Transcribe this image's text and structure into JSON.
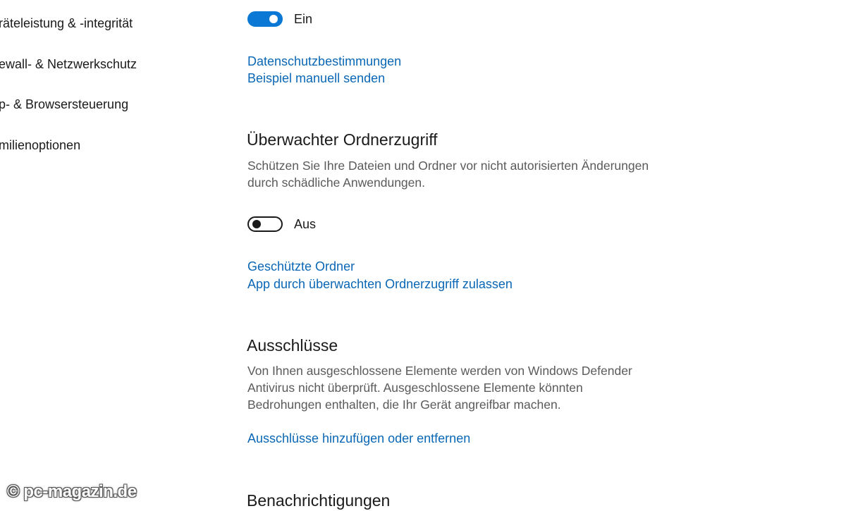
{
  "sidebar": {
    "items": [
      {
        "label": "räteleistung & -integrität"
      },
      {
        "label": "ewall- & Netzwerkschutz"
      },
      {
        "label": "p- & Browsersteuerung"
      },
      {
        "label": "milienoptionen"
      }
    ]
  },
  "sample_submission": {
    "toggle_state": "on",
    "toggle_label": "Ein",
    "links": {
      "privacy": "Datenschutzbestimmungen",
      "send_sample": "Beispiel manuell senden"
    }
  },
  "controlled_folder_access": {
    "heading": "Überwachter Ordnerzugriff",
    "description_lines": [
      "Schützen Sie Ihre Dateien und Ordner vor nicht autorisierten Änderungen",
      "durch schädliche Anwendungen."
    ],
    "toggle_state": "off",
    "toggle_label": "Aus",
    "links": {
      "protected_folders": "Geschützte Ordner",
      "allow_app": "App durch überwachten Ordnerzugriff zulassen"
    }
  },
  "exclusions": {
    "heading": "Ausschlüsse",
    "description_lines": [
      "Von Ihnen ausgeschlossene Elemente werden von Windows Defender",
      "Antivirus nicht überprüft. Ausgeschlossene Elemente könnten",
      "Bedrohungen enthalten, die Ihr Gerät angreifbar machen."
    ],
    "links": {
      "add_remove": "Ausschlüsse hinzufügen oder entfernen"
    }
  },
  "notifications": {
    "heading": "Benachrichtigungen"
  },
  "watermark": {
    "text": "© pc-magazin.de"
  },
  "colors": {
    "accent": "#0a78d4",
    "link": "#0a67b5",
    "text": "#1a1a1a",
    "secondary_text": "#5a5a5a",
    "background": "#ffffff"
  }
}
